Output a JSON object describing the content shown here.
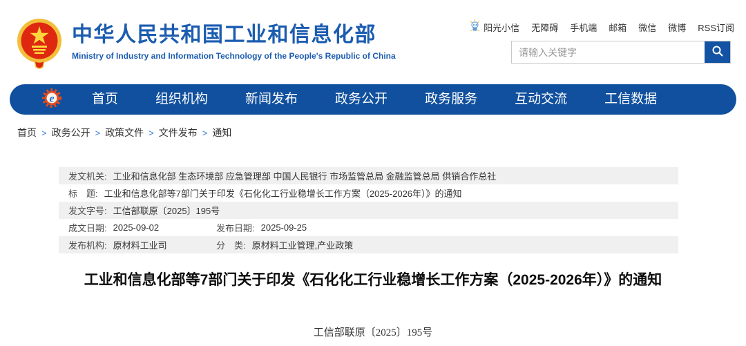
{
  "colors": {
    "brand_blue": "#1b5cb0",
    "nav_blue": "#11509e",
    "search_button_blue": "#1353a3",
    "breadcrumb_separator_blue": "#3a7bd5",
    "meta_row_gray": "#f0f0f1",
    "emblem_red": "#de2910",
    "emblem_gold": "#f7c948",
    "logo_gear_red": "#e34a1f"
  },
  "header": {
    "site_name": "中华人民共和国工业和信息化部",
    "site_name_en": "Ministry of Industry and Information Technology of the People's Republic of China",
    "quick_links": [
      "阳光小信",
      "无障碍",
      "手机端",
      "邮箱",
      "微信",
      "微博",
      "RSS订阅"
    ],
    "search_placeholder": "请输入关键字",
    "icons": {
      "emblem": "national-emblem",
      "mascot": "sunshine-xiaoxin-mascot",
      "search": "magnifier"
    }
  },
  "nav": {
    "logo_icon": "miit-gear-logo",
    "items": [
      "首页",
      "组织机构",
      "新闻发布",
      "政务公开",
      "政务服务",
      "互动交流",
      "工信数据"
    ]
  },
  "breadcrumb": {
    "separator": ">",
    "items": [
      "首页",
      "政务公开",
      "政策文件",
      "文件发布",
      "通知"
    ]
  },
  "doc_meta": {
    "rows": [
      {
        "label1": "发文机关:",
        "value1": "工业和信息化部 生态环境部 应急管理部 中国人民银行 市场监管总局 金融监管总局 供销合作总社"
      },
      {
        "label1": "标　题:",
        "value1": "工业和信息化部等7部门关于印发《石化化工行业稳增长工作方案（2025-2026年）》的通知"
      },
      {
        "label1": "发文字号:",
        "value1": "工信部联原〔2025〕195号"
      },
      {
        "label1": "成文日期:",
        "value1": "2025-09-02",
        "label2": "发布日期:",
        "value2": "2025-09-25"
      },
      {
        "label1": "发布机构:",
        "value1": "原材料工业司",
        "label2": "分　类:",
        "value2": "原材料工业管理,产业政策"
      }
    ]
  },
  "article": {
    "title": "工业和信息化部等7部门关于印发《石化化工行业稳增长工作方案（2025-2026年）》的通知",
    "doc_number": "工信部联原〔2025〕195号"
  }
}
